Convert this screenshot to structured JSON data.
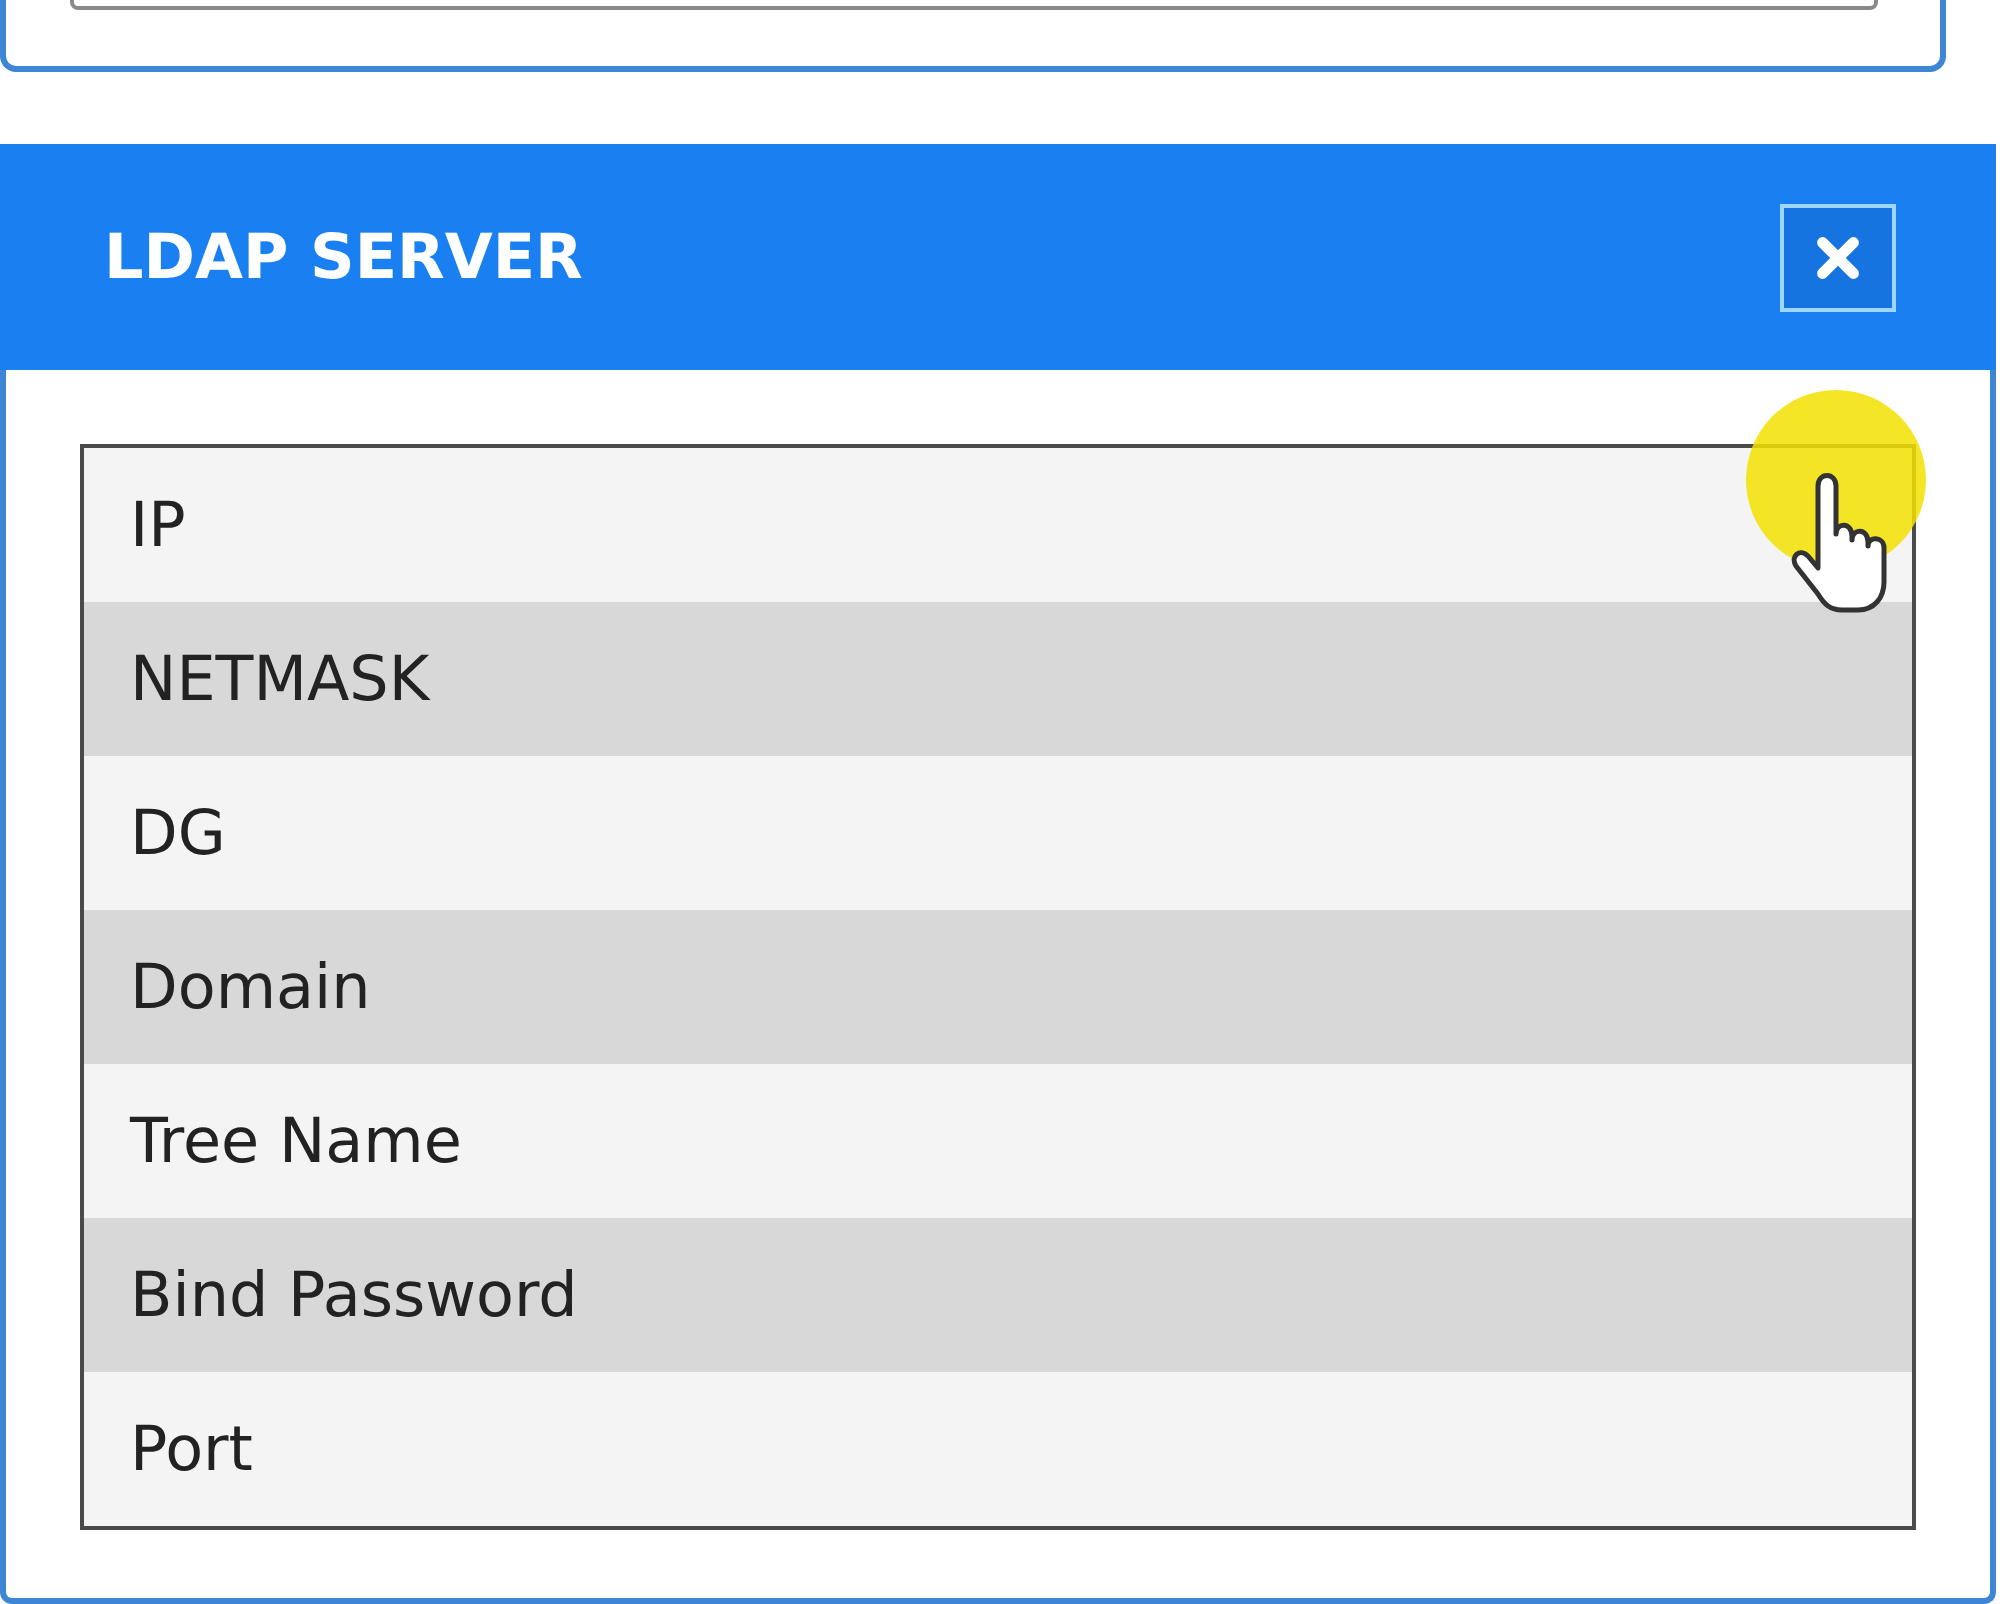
{
  "dialog": {
    "title": "LDAP SERVER",
    "rows": [
      {
        "label": "IP"
      },
      {
        "label": "NETMASK"
      },
      {
        "label": "DG"
      },
      {
        "label": "Domain"
      },
      {
        "label": "Tree Name"
      },
      {
        "label": "Bind Password"
      },
      {
        "label": "Port"
      }
    ]
  }
}
